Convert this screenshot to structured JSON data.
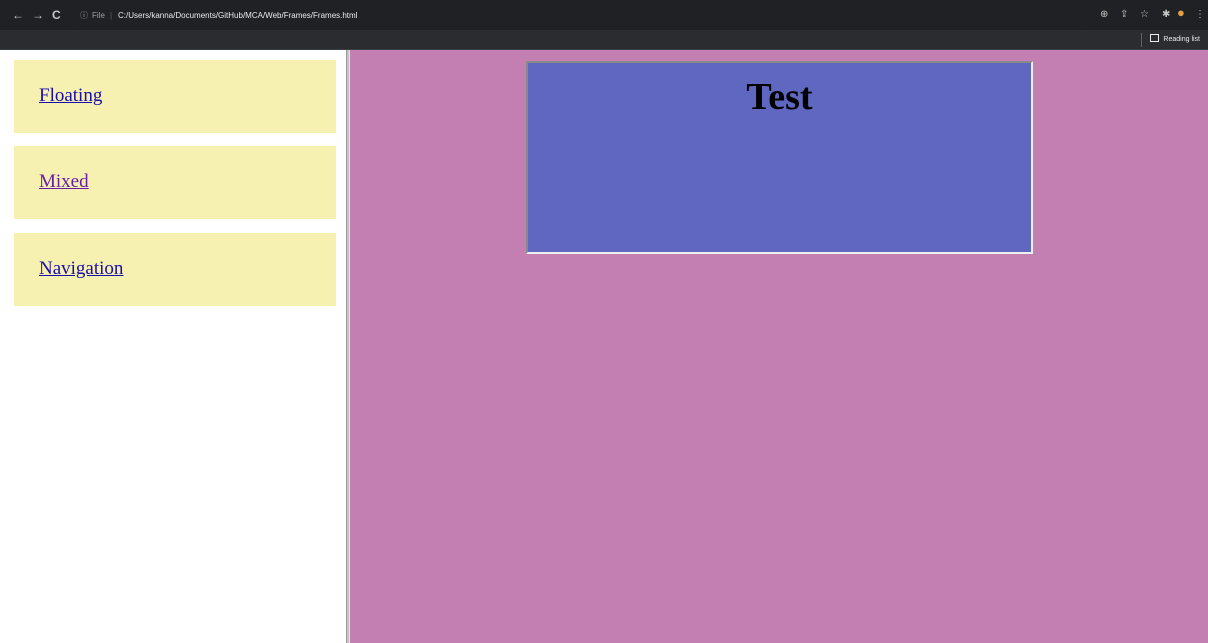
{
  "browser": {
    "back_glyph": "←",
    "forward_glyph": "→",
    "reload_glyph": "C",
    "info_glyph": "ⓘ",
    "scheme_label": "File",
    "separator": "|",
    "url": "C:/Users/kanna/Documents/GitHub/MCA/Web/Frames/Frames.html",
    "zoom_glyph": "⊕",
    "share_glyph": "⇪",
    "star_glyph": "☆",
    "extensions_glyph": "✱",
    "profile_glyph": "●",
    "menu_glyph": "⋮",
    "reading_list_label": "Reading list"
  },
  "sidebar": {
    "links": [
      {
        "label": "Floating",
        "state": "unvisited"
      },
      {
        "label": "Mixed",
        "state": "visited"
      },
      {
        "label": "Navigation",
        "state": "unvisited"
      }
    ]
  },
  "main": {
    "heading": "Test"
  },
  "colors": {
    "toolbar_bg": "#202124",
    "sidebar_box_bg": "#f7f1b1",
    "main_bg": "#c47fb2",
    "test_box_bg": "#5f67c1",
    "link_unvisited": "#1a0dab",
    "link_visited": "#681da8"
  }
}
